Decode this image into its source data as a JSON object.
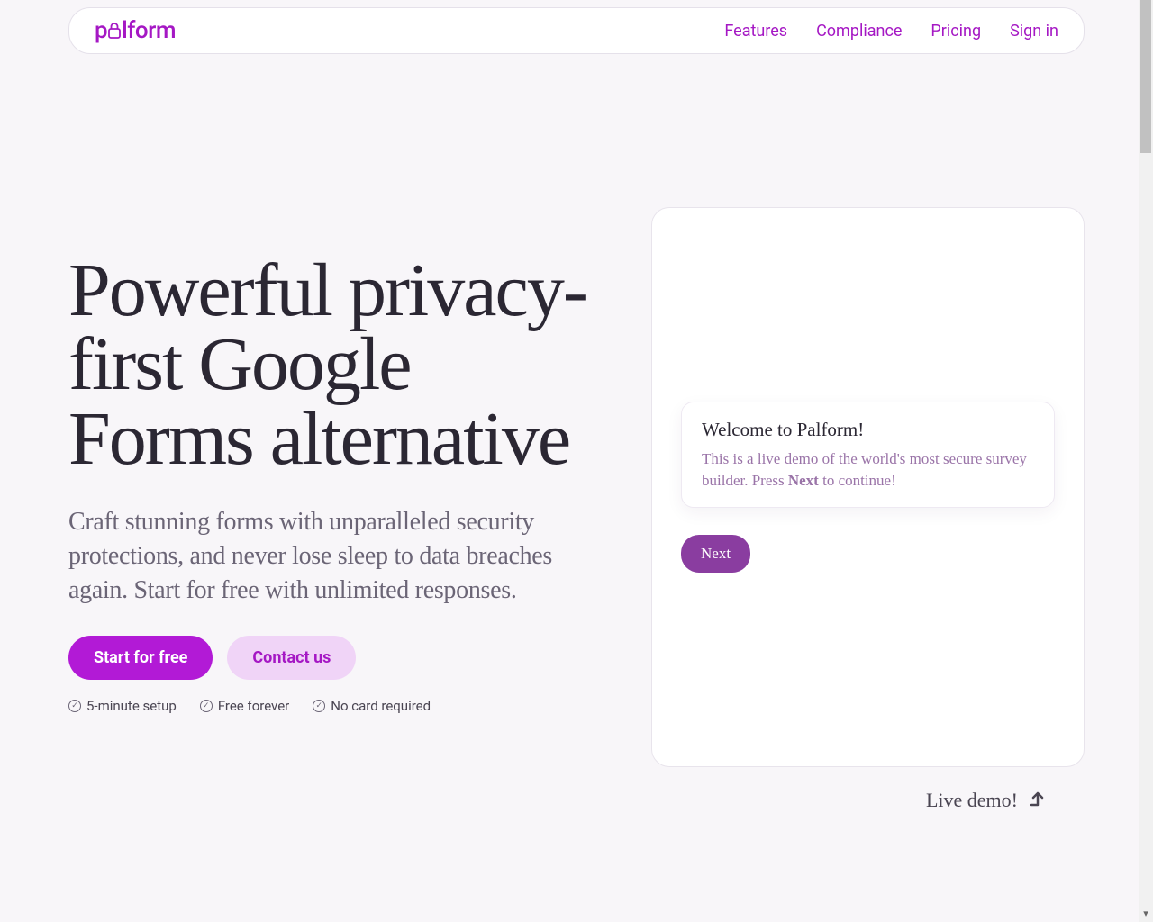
{
  "logo": {
    "prefix": "p",
    "suffix": "lform"
  },
  "nav": {
    "features": "Features",
    "compliance": "Compliance",
    "pricing": "Pricing",
    "signin": "Sign in"
  },
  "hero": {
    "title": "Powerful privacy-first Google Forms alternative",
    "subtitle": "Craft stunning forms with unparalleled security protections, and never lose sleep to data breaches again. Start for free with unlimited responses.",
    "cta_primary": "Start for free",
    "cta_secondary": "Contact us",
    "badges": {
      "setup": "5-minute setup",
      "free": "Free forever",
      "nocard": "No card required"
    }
  },
  "demo": {
    "card_title": "Welcome to Palform!",
    "card_text_before": "This is a live demo of the world's most secure survey builder. Press ",
    "card_text_bold": "Next",
    "card_text_after": " to continue!",
    "next_label": "Next",
    "live_label": "Live demo!"
  },
  "colors": {
    "brand": "#a518c4",
    "primary_btn": "#b21ad6",
    "secondary_btn_bg": "#f0d4f7",
    "next_btn": "#8a3da0",
    "text_dark": "#2b2733",
    "text_muted": "#6b6576",
    "demo_text": "#9a74a8"
  }
}
